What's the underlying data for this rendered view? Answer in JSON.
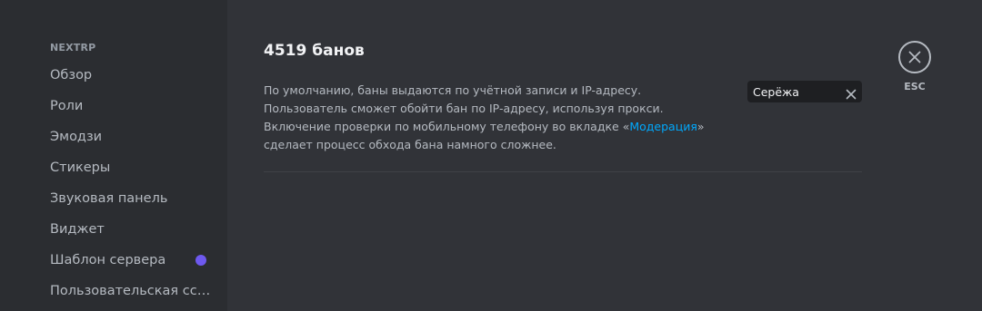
{
  "sidebar": {
    "header": "NEXTRP",
    "items": [
      {
        "label": "Обзор"
      },
      {
        "label": "Роли"
      },
      {
        "label": "Эмодзи"
      },
      {
        "label": "Стикеры"
      },
      {
        "label": "Звуковая панель"
      },
      {
        "label": "Виджет"
      },
      {
        "label": "Шаблон сервера"
      },
      {
        "label": "Пользовательская ссылка"
      }
    ]
  },
  "main": {
    "title": "4519 банов",
    "description": {
      "before": "По умолчанию, баны выдаются по учётной записи и IP-адресу. Пользователь сможет обойти бан по IP-адресу, используя прокси. Включение проверки по мобильному телефону во вкладке «",
      "link": "Модерация",
      "after": "» сделает процесс обхода бана намного сложнее."
    },
    "search": {
      "value": "Серёжа"
    }
  },
  "close": {
    "label": "ESC"
  },
  "icons": {
    "clear": "close-icon",
    "esc": "close-circle-icon",
    "new_badge": "dot-badge"
  },
  "colors": {
    "badge": "#6e59ef",
    "link": "#00a8fc"
  }
}
